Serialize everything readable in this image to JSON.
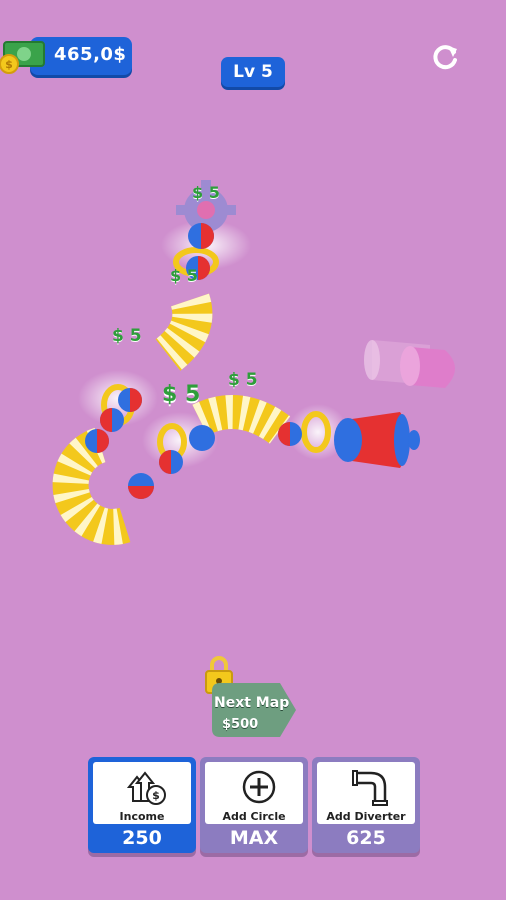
{
  "hud": {
    "money": "465,0$",
    "level": "Lv  5"
  },
  "floating_labels": [
    "$ 5",
    "$ 5",
    "$ 5",
    "$ 5",
    "$ 5"
  ],
  "next_map": {
    "label": "Next Map",
    "price": "$500"
  },
  "upgrades": [
    {
      "title": "Income",
      "value": "250",
      "icon": "income-arrows-icon",
      "active": true
    },
    {
      "title": "Add Circle",
      "value": "MAX",
      "icon": "plus-circle-icon",
      "active": false
    },
    {
      "title": "Add Diverter",
      "value": "625",
      "icon": "pipe-elbow-icon",
      "active": false
    }
  ],
  "colors": {
    "background": "#cf8fce",
    "accent_blue": "#1e63d9",
    "card_active": "#1e63d9",
    "card_inactive": "#8c7cc0",
    "money_green": "#2e9e3a",
    "pipe_yellow": "#f3c81c"
  }
}
